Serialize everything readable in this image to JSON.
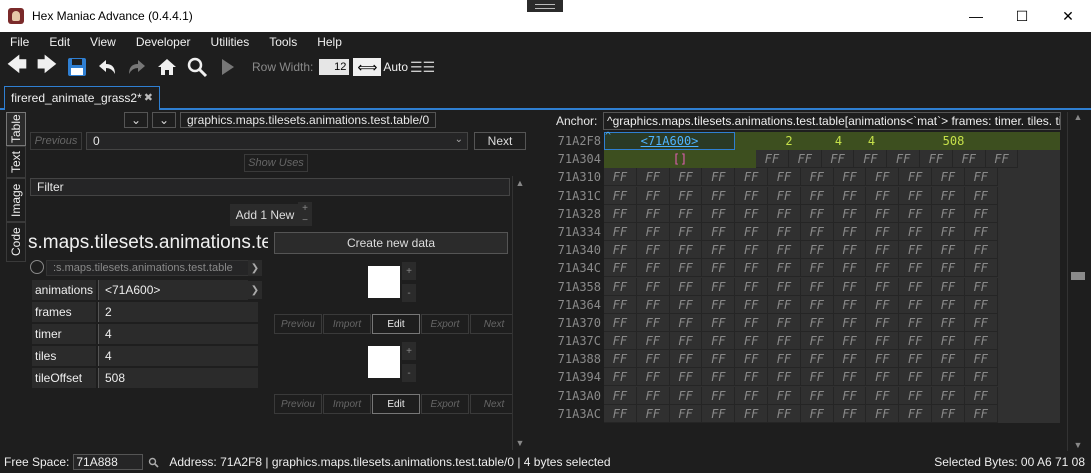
{
  "window": {
    "title": "Hex Maniac Advance (0.4.4.1)",
    "minimize": "—",
    "maximize": "☐",
    "close": "✕"
  },
  "menu": [
    "File",
    "Edit",
    "View",
    "Developer",
    "Utilities",
    "Tools",
    "Help"
  ],
  "toolbar": {
    "row_width_label": "Row Width:",
    "row_width_value": "12",
    "auto_label": "Auto"
  },
  "tab": {
    "label": "firered_animate_grass2*",
    "close": "✖"
  },
  "sidetabs": [
    "Table",
    "Text",
    "Image",
    "Code"
  ],
  "table": {
    "table_name": "graphics.maps.tilesets.animations.test.table/0",
    "previous_label": "Previous",
    "index_value": "0",
    "next_label": "Next",
    "show_uses_label": "Show Uses",
    "filter_label": "Filter",
    "add_new_label": "Add 1 New",
    "big_title": "s.maps.tilesets.animations.te",
    "sub_title": ":s.maps.tilesets.animations.test.table",
    "create_new_label": "Create new data",
    "fields": [
      {
        "label": "animations",
        "value": "<71A600>"
      },
      {
        "label": "frames",
        "value": "2"
      },
      {
        "label": "timer",
        "value": "4"
      },
      {
        "label": "tiles",
        "value": "4"
      },
      {
        "label": "tileOffset",
        "value": "508"
      }
    ],
    "image_toolbar": [
      "Previou",
      "Import",
      "Edit",
      "Export",
      "Next"
    ]
  },
  "hex": {
    "anchor_label": "Anchor:",
    "anchor_value": "^graphics.maps.tilesets.animations.test.table[animations<`mat`> frames: timer. tiles. tileOffset]",
    "addresses": [
      "71A2F8",
      "71A304",
      "71A310",
      "71A31C",
      "71A328",
      "71A334",
      "71A340",
      "71A34C",
      "71A358",
      "71A364",
      "71A370",
      "71A37C",
      "71A388",
      "71A394",
      "71A3A0",
      "71A3AC"
    ],
    "empty_byte": "FF",
    "struct_row": {
      "pointer": "<71A600>",
      "frames": "2",
      "timer": "4",
      "tiles": "4",
      "tileOffset": "508"
    },
    "bracket": "[]",
    "caret": "^"
  },
  "status": {
    "free_space_label": "Free Space:",
    "free_space_value": "71A888",
    "address_text": "Address: 71A2F8 | graphics.maps.tilesets.animations.test.table/0 | 4 bytes selected",
    "selected_bytes": "Selected Bytes: 00 A6 71 08"
  }
}
